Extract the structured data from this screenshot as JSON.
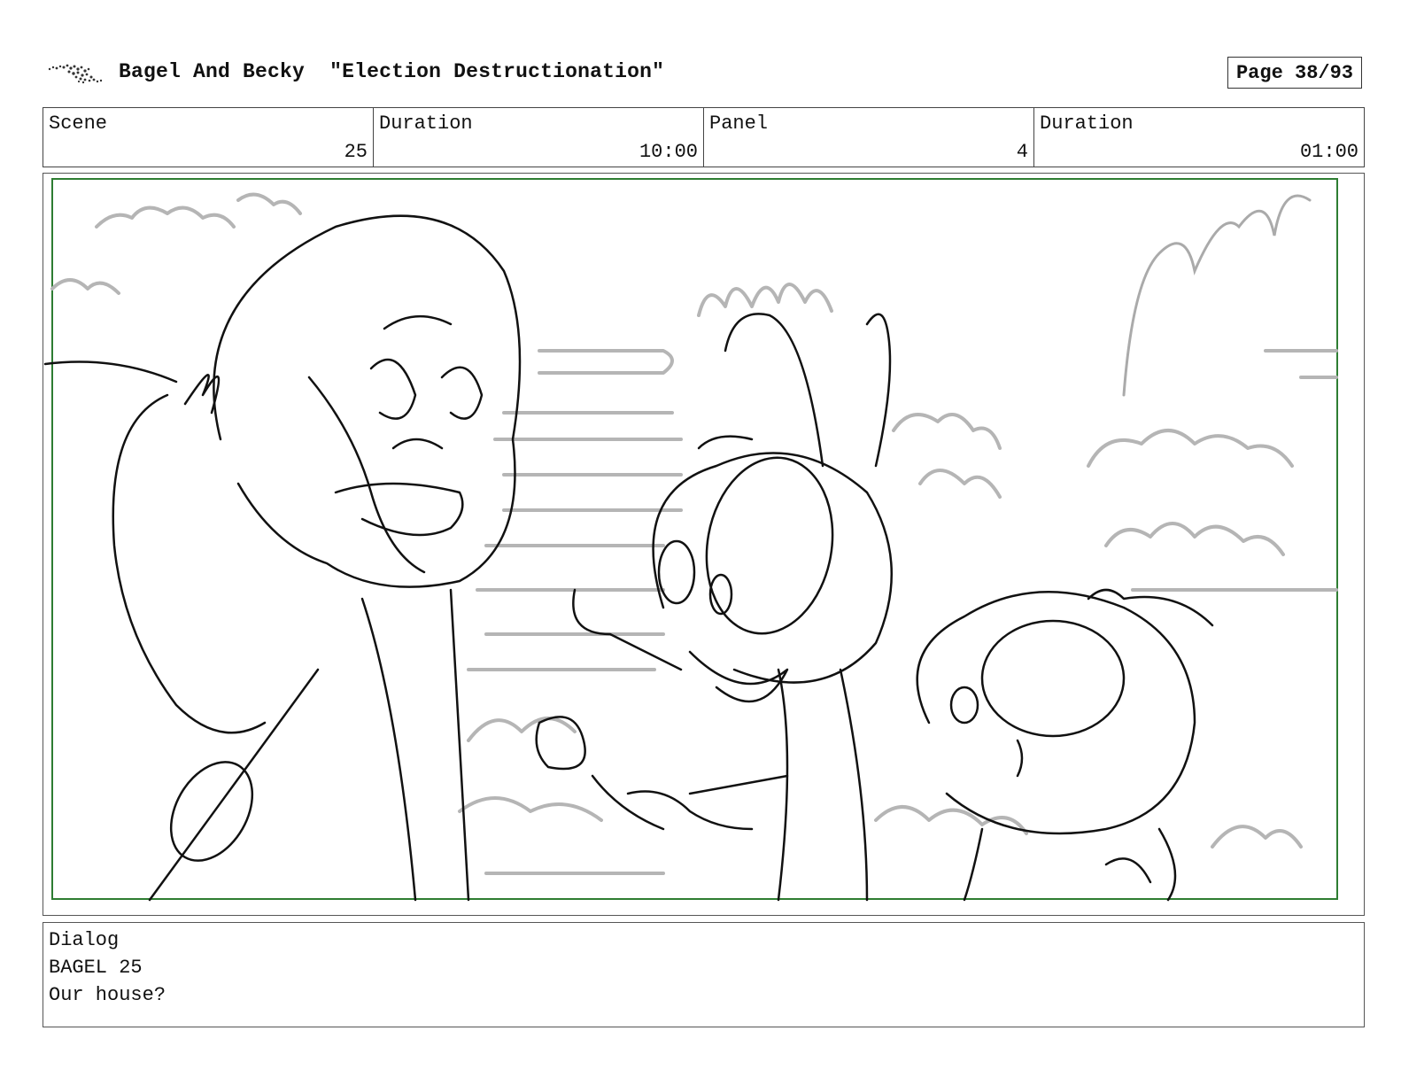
{
  "header": {
    "show_title": "Bagel And Becky",
    "episode_title": "\"Election Destructionation\"",
    "page_label": "Page 38/93",
    "logo_icon": "studio-logo-icon"
  },
  "info_bar": {
    "scene_label": "Scene",
    "scene_value": "25",
    "scene_duration_label": "Duration",
    "scene_duration_value": "10:00",
    "panel_label": "Panel",
    "panel_value": "4",
    "panel_duration_label": "Duration",
    "panel_duration_value": "01:00"
  },
  "panel": {
    "frame_color": "#2e7d32"
  },
  "dialog": {
    "label": "Dialog",
    "character": "BAGEL 25",
    "line": "Our house?"
  }
}
